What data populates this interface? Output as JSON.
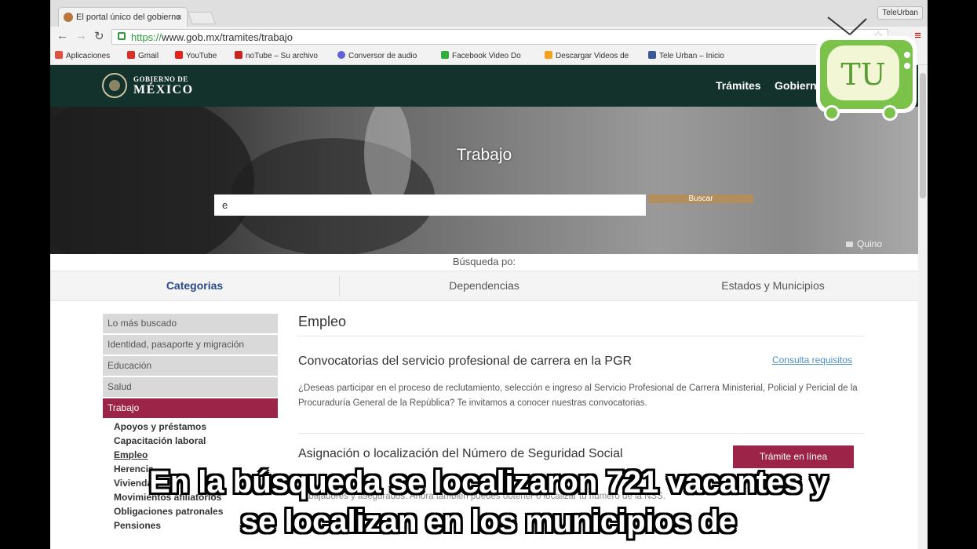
{
  "browser": {
    "tab_title": "El portal único del gobierno",
    "tab_close": "×",
    "profile_label": "TeleUrban",
    "url_https": "https://",
    "url_rest": "www.gob.mx/tramites/trabajo",
    "bookmarks": [
      {
        "label": "Aplicaciones",
        "icon": "apps-grid-icon",
        "color": "#e0523f"
      },
      {
        "label": "Gmail",
        "icon": "gmail-icon",
        "color": "#d93025"
      },
      {
        "label": "YouTube",
        "icon": "youtube-icon",
        "color": "#e62117"
      },
      {
        "label": "noTube – Su archivo",
        "icon": "notube-icon",
        "color": "#cc2222"
      },
      {
        "label": "Conversor de audio",
        "icon": "converter-icon",
        "color": "#5d64d8"
      },
      {
        "label": "Facebook Video Do",
        "icon": "facebook-video-icon",
        "color": "#2fae3a"
      },
      {
        "label": "Descargar Videos de",
        "icon": "download-videos-icon",
        "color": "#f4a21e"
      },
      {
        "label": "Tele Urban – Inicio",
        "icon": "facebook-icon",
        "color": "#3b5998"
      }
    ]
  },
  "site": {
    "logo_line1": "GOBIERNO DE",
    "logo_line2": "MÉXICO",
    "nav": [
      "Trámites",
      "Gobierno"
    ],
    "hero_title": "Trabajo",
    "search_value": "e",
    "search_button": "Buscar",
    "photo_credit": "Quino",
    "search_by": "Búsqueda po:",
    "category_tabs": [
      "Categorias",
      "Dependencias",
      "Estados y Municipios"
    ],
    "sidebar": [
      "Lo más buscado",
      "Identidad, pasaporte y migración",
      "Educación",
      "Salud",
      "Trabajo"
    ],
    "sidebar_sub": [
      "Apoyos y préstamos",
      "Capacitación laboral",
      "Empleo",
      "Herencia",
      "Vivienda",
      "Movimientos afiliatorios",
      "Obligaciones patronales",
      "Pensiones"
    ],
    "section_title": "Empleo",
    "proc1_title": "Convocatorias del servicio profesional de carrera en la PGR",
    "proc1_link": "Consulta requisitos",
    "proc1_desc": "¿Deseas participar en el proceso de reclutamiento, selección e ingreso al Servicio Profesional de Carrera Ministerial, Policial y Pericial de la Procuraduría General de la República? Te invitamos a conocer nuestras convocatorias.",
    "proc2_title": "Asignación o localización del Número de Seguridad Social",
    "proc2_button": "Trámite en línea",
    "proc2_desc": "trabajadores y asegurados. Ahora también puedes obtener o localizar tu número de la NSS."
  },
  "overlay": {
    "logo_text": "TU",
    "subtitle_line1": "En la búsqueda se localizaron 721 vacantes y",
    "subtitle_line2": "se localizan en los municipios de"
  }
}
